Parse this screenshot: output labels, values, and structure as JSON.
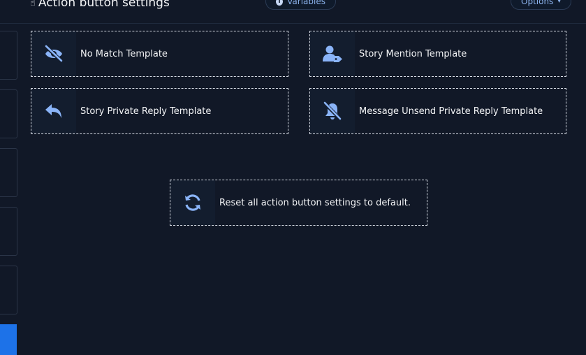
{
  "header": {
    "title": "Action button settings",
    "variables_label": "Variables",
    "options_label": "Options"
  },
  "cards": {
    "no_match": {
      "label": "No Match Template",
      "icon": "eye-slash-icon"
    },
    "story_mention": {
      "label": "Story Mention Template",
      "icon": "user-tag-icon"
    },
    "story_private_reply": {
      "label": "Story Private Reply Template",
      "icon": "reply-icon"
    },
    "message_unsend": {
      "label": "Message Unsend Private Reply Template",
      "icon": "bell-slash-icon"
    }
  },
  "reset": {
    "label": "Reset all action button settings to default.",
    "icon": "sync-icon"
  },
  "colors": {
    "background": "#111827",
    "icon_accent": "#8ab4f8",
    "active_tab": "#1d72e8"
  }
}
